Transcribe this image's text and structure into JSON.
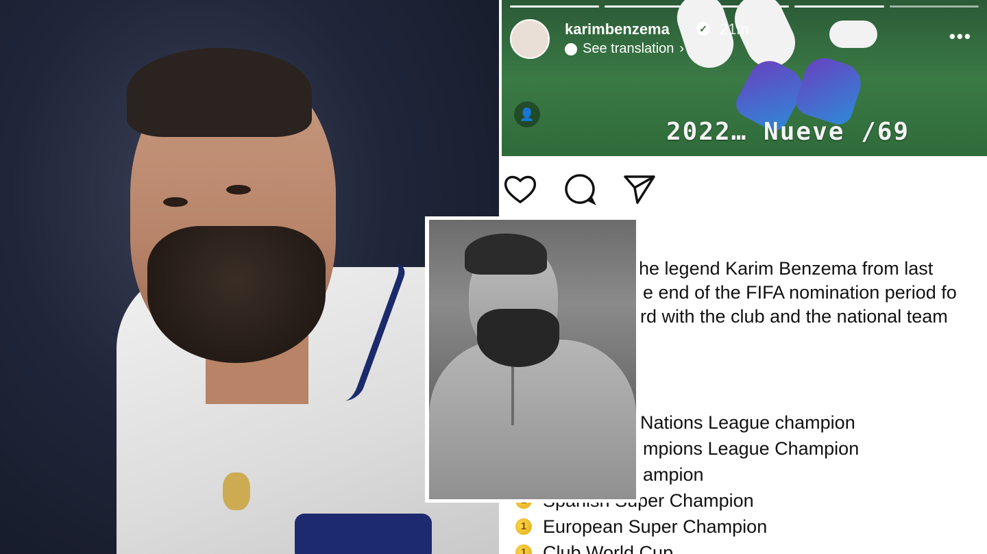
{
  "story": {
    "username": "karimbenzema",
    "time": "21m",
    "see_translation": "See translation",
    "more": "•••",
    "caption": "2022… Nueve /69"
  },
  "post": {
    "lines": [
      "he legend Karim Benzema from last",
      "e end of the FIFA nomination period fo",
      "rd with the club and the national team"
    ],
    "titles": [
      "Nations League champion",
      "mpions League Champion",
      "ampion",
      "Spanish Super Champion",
      "European Super Champion",
      "Club World Cup"
    ]
  },
  "icons": {
    "like": "heart-icon",
    "comment": "comment-icon",
    "share": "send-icon",
    "verified": "verified-badge-icon",
    "medal": "medal-icon"
  }
}
